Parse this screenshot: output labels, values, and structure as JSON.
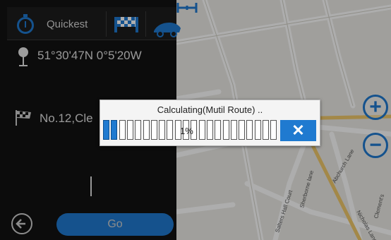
{
  "route_tabs": {
    "active_label": "Quickest",
    "icons": [
      "stopwatch-icon",
      "checkered-flag-icon",
      "car-icon"
    ]
  },
  "start": {
    "icon": "location-pin-icon",
    "coordinates": "51°30'47N  0°5'20W"
  },
  "destination": {
    "icon": "checkered-flag-icon",
    "text": "No.12,Cle"
  },
  "bottom_bar": {
    "back_icon": "back-arrow-icon",
    "go_label": "Go"
  },
  "map": {
    "zoom_in_label": "+",
    "zoom_out_label": "−",
    "street_labels": [
      "Salters Hall Court",
      "Sherborne lane",
      "Abchurch Lane",
      "Nicholas Lane",
      "Clement's"
    ]
  },
  "dialog": {
    "title": "Calculating(Mutil Route) ..",
    "progress_text": "1%",
    "progress_percent": 1,
    "filled_segments": 2,
    "total_segments": 22,
    "cancel_label": "✕"
  },
  "colors": {
    "accent": "#1f7ad0",
    "panel_bg": "#121212",
    "map_bg": "#ecebe6"
  }
}
